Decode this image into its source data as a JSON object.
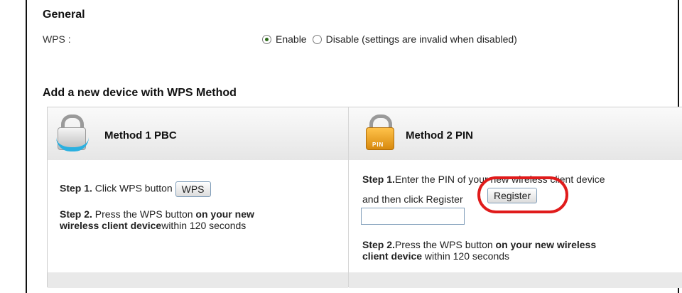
{
  "general": {
    "title": "General",
    "wps_label": "WPS :",
    "enable_label": "Enable",
    "disable_label": "Disable (settings are invalid when disabled)",
    "selected": "Enable"
  },
  "add_device": {
    "title": "Add a new device with WPS Method"
  },
  "method1": {
    "title": "Method 1 PBC",
    "step1_bold": "Step 1.",
    "step1_text": " Click WPS button",
    "wps_button": "WPS",
    "step2_bold": "Step 2.",
    "step2_text": " Press the WPS button ",
    "step2_bold2a": "on your new",
    "step2_bold2b": "wireless client device",
    "step2_tail": "within 120 seconds"
  },
  "method2": {
    "title": "Method 2 PIN",
    "pin_icon_text": "PIN",
    "step1_bold": "Step 1.",
    "step1_text_a": "Enter the PIN of your new wireless client device",
    "step1_text_b": "and then click Register",
    "register_button": "Register",
    "pin_value": "",
    "step2_bold": "Step 2.",
    "step2_text": "Press the WPS button ",
    "step2_bold2a": "on your new wireless",
    "step2_bold2b": "client device",
    "step2_tail": " within 120 seconds"
  },
  "colors": {
    "highlight": "#e01b1b",
    "radio_selected": "#2d6b1a",
    "lock_accent": "#2ab0e0",
    "pin_lock": "#f0a020"
  }
}
